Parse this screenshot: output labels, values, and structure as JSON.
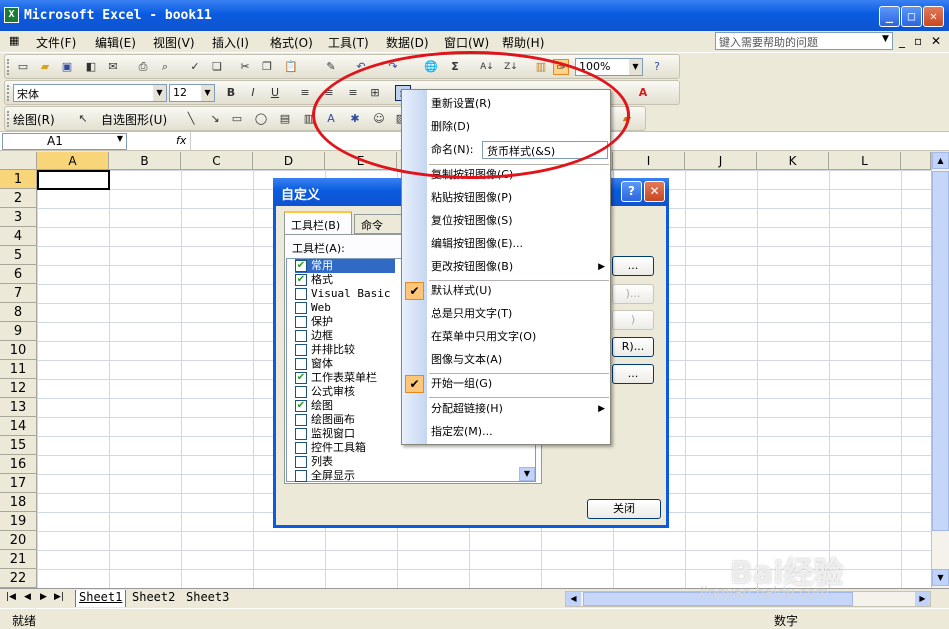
{
  "window": {
    "title": "Microsoft Excel - book11",
    "app_icon": "X"
  },
  "menu": {
    "items": [
      "文件(F)",
      "编辑(E)",
      "视图(V)",
      "插入(I)",
      "格式(O)",
      "工具(T)",
      "数据(D)",
      "窗口(W)",
      "帮助(H)"
    ],
    "help_placeholder": "键入需要帮助的问题"
  },
  "toolbar": {
    "zoom": "100%",
    "font_name": "宋体",
    "font_size": "12",
    "draw_label": "绘图(R)",
    "autoshape_label": "自选图形(U)"
  },
  "formula": {
    "cell_ref": "A1",
    "fx": "fx"
  },
  "columns": [
    "A",
    "B",
    "C",
    "D",
    "E",
    "F",
    "G",
    "H",
    "I",
    "J",
    "K",
    "L"
  ],
  "rows": [
    "1",
    "2",
    "3",
    "4",
    "5",
    "6",
    "7",
    "8",
    "9",
    "10",
    "11",
    "12",
    "13",
    "14",
    "15",
    "16",
    "17",
    "18",
    "19",
    "20",
    "21",
    "22"
  ],
  "sheets": [
    "Sheet1",
    "Sheet2",
    "Sheet3"
  ],
  "status": {
    "left": "就绪",
    "right": "数字"
  },
  "dialog": {
    "title": "自定义",
    "tabs": [
      "工具栏(B)",
      "命令(C)"
    ],
    "list_label": "工具栏(A):",
    "help_btn": "?",
    "close_button": "关闭",
    "toolbars": [
      {
        "label": "常用",
        "checked": true
      },
      {
        "label": "格式",
        "checked": true
      },
      {
        "label": "Visual Basic",
        "checked": false
      },
      {
        "label": "Web",
        "checked": false
      },
      {
        "label": "保护",
        "checked": false
      },
      {
        "label": "边框",
        "checked": false
      },
      {
        "label": "并排比较",
        "checked": false
      },
      {
        "label": "窗体",
        "checked": false
      },
      {
        "label": "工作表菜单栏",
        "checked": true
      },
      {
        "label": "公式审核",
        "checked": false
      },
      {
        "label": "绘图",
        "checked": true
      },
      {
        "label": "绘图画布",
        "checked": false
      },
      {
        "label": "监视窗口",
        "checked": false
      },
      {
        "label": "控件工具箱",
        "checked": false
      },
      {
        "label": "列表",
        "checked": false
      },
      {
        "label": "全屏显示",
        "checked": false
      }
    ]
  },
  "context_menu": {
    "reset": "重新设置(R)",
    "delete": "删除(D)",
    "name_label": "命名(N):",
    "name_value": "货币样式(&S)",
    "copy_image": "复制按钮图像(C)",
    "paste_image": "粘贴按钮图像(P)",
    "reset_image": "复位按钮图像(S)",
    "edit_image": "编辑按钮图像(E)...",
    "change_image": "更改按钮图像(B)",
    "default_style": "默认样式(U)",
    "text_only_always": "总是只用文字(T)",
    "text_only_menu": "在菜单中只用文字(O)",
    "image_and_text": "图像与文本(A)",
    "begin_group": "开始一组(G)",
    "assign_hyperlink": "分配超链接(H)",
    "assign_macro": "指定宏(M)..."
  },
  "watermark": {
    "brand": "Bai经验",
    "url": "jingyan.baidu.com"
  }
}
